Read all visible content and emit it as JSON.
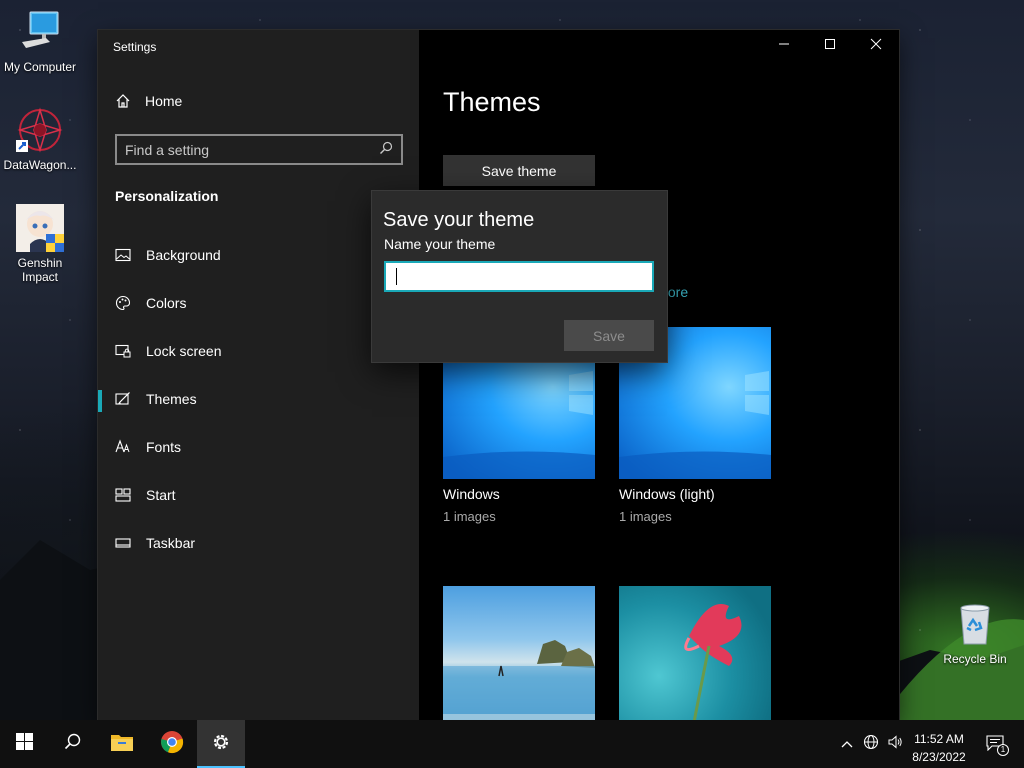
{
  "desktop": {
    "icons": [
      {
        "label": "My Computer"
      },
      {
        "label": "DataWagon..."
      },
      {
        "label": "Genshin Impact"
      },
      {
        "label": "Recycle Bin"
      }
    ]
  },
  "window": {
    "title": "Settings",
    "controls": [
      "minimize-icon",
      "maximize-icon",
      "close-icon"
    ]
  },
  "sidebar": {
    "home_label": "Home",
    "search_placeholder": "Find a setting",
    "section_title": "Personalization",
    "items": [
      {
        "label": "Background",
        "icon": "picture-icon"
      },
      {
        "label": "Colors",
        "icon": "palette-icon"
      },
      {
        "label": "Lock screen",
        "icon": "lock-screen-icon"
      },
      {
        "label": "Themes",
        "icon": "themes-icon",
        "active": true
      },
      {
        "label": "Fonts",
        "icon": "fonts-icon"
      },
      {
        "label": "Start",
        "icon": "start-icon"
      },
      {
        "label": "Taskbar",
        "icon": "taskbar-icon"
      }
    ]
  },
  "main": {
    "title": "Themes",
    "save_theme_label": "Save theme",
    "store_link_partial": "tore",
    "themes": [
      {
        "name": "Windows",
        "count": "1 images"
      },
      {
        "name": "Windows (light)",
        "count": "1 images"
      },
      {
        "name": "",
        "count": ""
      },
      {
        "name": "",
        "count": ""
      }
    ]
  },
  "dialog": {
    "title": "Save your theme",
    "label": "Name your theme",
    "input_value": "",
    "save_label": "Save"
  },
  "taskbar": {
    "apps": [
      "start-icon",
      "search-icon",
      "file-explorer-icon",
      "chrome-icon",
      "settings-icon"
    ],
    "time": "11:52 AM",
    "date": "8/23/2022",
    "notification_count": "1"
  },
  "colors": {
    "accent": "#1aa9b8",
    "link": "#3cb6c8",
    "sidebar_bg": "#1f1f1f",
    "dialog_bg": "#2b2b2b"
  }
}
